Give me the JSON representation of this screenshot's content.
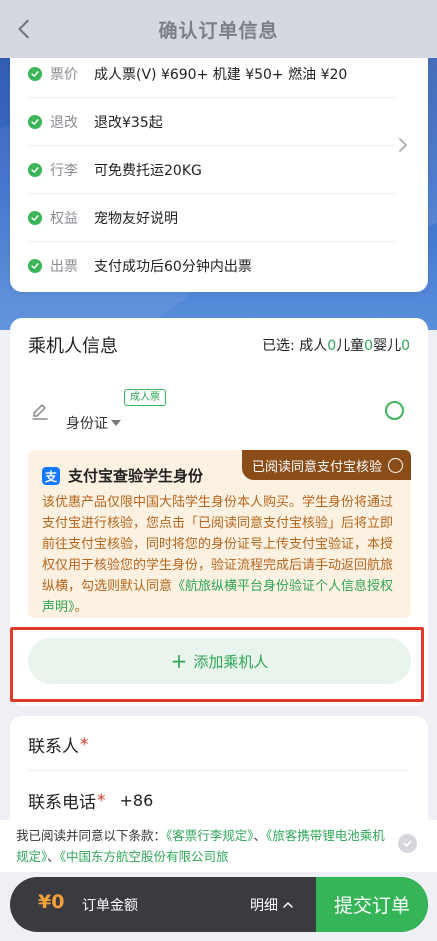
{
  "header": {
    "title": "确认订单信息"
  },
  "policy": {
    "items": [
      {
        "label": "票价",
        "value": "成人票(V) ¥690+ 机建 ¥50+ 燃油 ¥20"
      },
      {
        "label": "退改",
        "value": "退改¥35起"
      },
      {
        "label": "行李",
        "value": "可免费托运20KG"
      },
      {
        "label": "权益",
        "value": "宠物友好说明"
      },
      {
        "label": "出票",
        "value": "支付成功后60分钟内出票"
      }
    ]
  },
  "passenger": {
    "title": "乘机人信息",
    "selected_prefix": "已选:",
    "adult_label": "成人",
    "adult_count": "0",
    "child_label": "儿童",
    "child_count": "0",
    "infant_label": "婴儿",
    "infant_count": "0",
    "badge": "成人票",
    "id_type": "身份证",
    "verify": {
      "consent_label": "已阅读同意支付宝核验",
      "alipay_glyph": "支",
      "title": "支付宝查验学生身份",
      "body": "该优惠产品仅限中国大陆学生身份本人购买。学生身份将通过支付宝进行核验，您点击「已阅读同意支付宝核验」后将立即前往支付宝核验，同时将您的身份证号上传支付宝验证，本授权仅用于核验您的学生身份，验证流程完成后请手动返回航旅纵横，勾选则默认同意",
      "link": "《航旅纵横平台身份验证个人信息授权声明》",
      "end": "。"
    },
    "add_button": "添加乘机人"
  },
  "contact": {
    "name_label": "联系人",
    "phone_label": "联系电话",
    "required_mark": "*",
    "phone_code": "+86"
  },
  "terms": {
    "prefix": "我已阅读并同意以下条款：",
    "link1": "《客票行李规定》",
    "sep1": "、",
    "link2": "《旅客携带锂电池乘机规定》",
    "sep2": "、",
    "link3": "《中国东方航空股份有限公司旅"
  },
  "footer": {
    "amount": "¥0",
    "amount_label": "订单金额",
    "detail_label": "明细",
    "submit_label": "提交订单"
  },
  "colors": {
    "accent_green": "#35b458",
    "header_blue": "#2f55a8",
    "warning_brown": "#8a4d18",
    "amount_orange": "#f5a13a",
    "highlight_red": "#e23a2a"
  }
}
